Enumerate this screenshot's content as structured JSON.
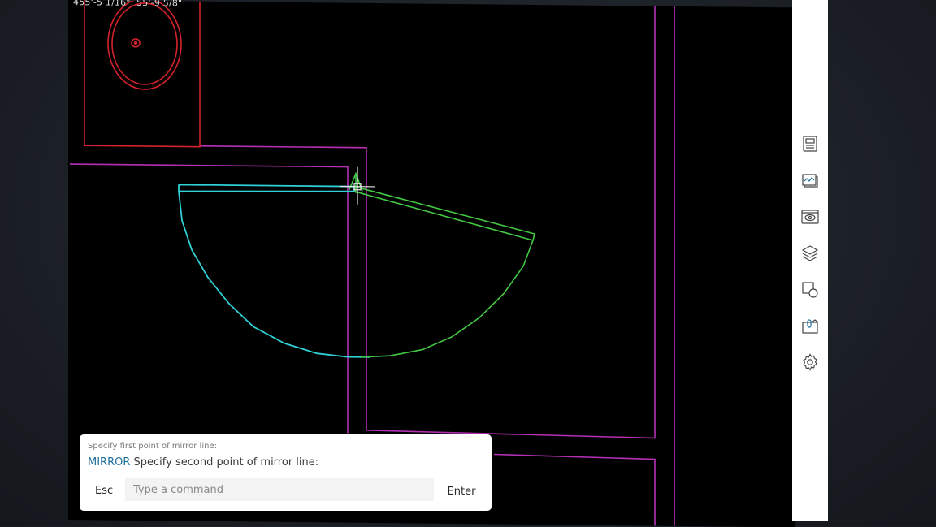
{
  "viewport": {
    "coordinates": "455'-5 1/16\",  55'-9 5/8\""
  },
  "toolbar": {
    "tools": [
      {
        "icon": "properties-icon"
      },
      {
        "icon": "sheets-icon"
      },
      {
        "icon": "view-icon"
      },
      {
        "icon": "layers-icon"
      },
      {
        "icon": "blocks-icon"
      },
      {
        "icon": "xref-icon"
      },
      {
        "icon": "settings-icon"
      }
    ]
  },
  "command": {
    "previous_prompt": "Specify first point of mirror line:",
    "active_command": "MIRROR",
    "current_prompt": "Specify second point of mirror line:",
    "esc_label": "Esc",
    "input_placeholder": "Type a command",
    "input_value": "",
    "enter_label": "Enter"
  },
  "colors": {
    "canvas_background": "#000000",
    "wall_lines": "#b530b5",
    "cabinet_lines": "#d4232c",
    "selected_object": "#2fd0d6",
    "mirror_preview": "#43c743",
    "command_accent": "#1f6f9a"
  }
}
